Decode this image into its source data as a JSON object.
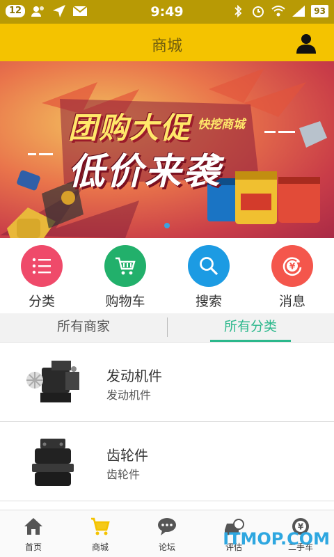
{
  "status_bar": {
    "notification_count": "12",
    "time": "9:49",
    "battery": "93"
  },
  "header": {
    "title": "商城"
  },
  "banner": {
    "brand": "快挖商城",
    "headline_line1": "团购大促",
    "headline_line2": "低价来袭",
    "slide_count": 1
  },
  "quick_actions": [
    {
      "label": "分类",
      "icon": "list-icon",
      "color": "#ef4a6a"
    },
    {
      "label": "购物车",
      "icon": "cart-icon",
      "color": "#22b06b"
    },
    {
      "label": "搜索",
      "icon": "search-icon",
      "color": "#1c9be3"
    },
    {
      "label": "消息",
      "icon": "yen-cycle-icon",
      "color": "#f4564c"
    }
  ],
  "tabs": [
    {
      "label": "所有商家",
      "active": false
    },
    {
      "label": "所有分类",
      "active": true
    }
  ],
  "categories": [
    {
      "name": "发动机件",
      "subtitle": "发动机件",
      "image": "engine-part-image"
    },
    {
      "name": "齿轮件",
      "subtitle": "齿轮件",
      "image": "gear-part-image"
    }
  ],
  "bottom_nav": [
    {
      "label": "首页",
      "icon": "home-icon",
      "active": false
    },
    {
      "label": "商城",
      "icon": "cart-icon",
      "active": true
    },
    {
      "label": "论坛",
      "icon": "chat-icon",
      "active": false
    },
    {
      "label": "评估",
      "icon": "car-estimate-icon",
      "active": false
    },
    {
      "label": "二手车",
      "icon": "yen-icon",
      "active": false
    }
  ],
  "watermark": "ITMOP.COM",
  "colors": {
    "status_bar": "#b89a05",
    "header": "#f4c300",
    "accent": "#2cb88c",
    "nav_active": "#f4c300"
  }
}
